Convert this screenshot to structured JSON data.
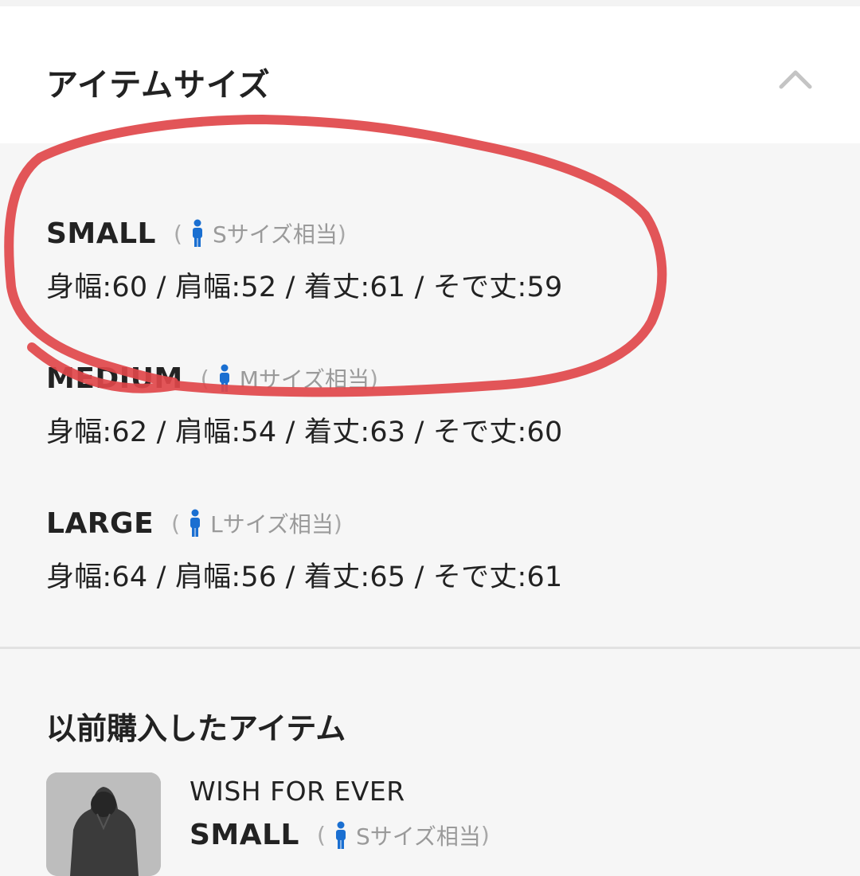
{
  "header": {
    "title": "アイテムサイズ"
  },
  "sizes": [
    {
      "name": "SMALL",
      "equiv_open": "(",
      "equiv": "Sサイズ相当",
      "equiv_close": ")",
      "measure": "身幅:60 / 肩幅:52 / 着丈:61 / そで丈:59"
    },
    {
      "name": "MEDIUM",
      "equiv_open": "(",
      "equiv": "Mサイズ相当",
      "equiv_close": ")",
      "measure": "身幅:62 / 肩幅:54 / 着丈:63 / そで丈:60"
    },
    {
      "name": "LARGE",
      "equiv_open": "(",
      "equiv": "Lサイズ相当",
      "equiv_close": ")",
      "measure": "身幅:64 / 肩幅:56 / 着丈:65 / そで丈:61"
    }
  ],
  "previous": {
    "title": "以前購入したアイテム",
    "item": {
      "name": "WISH FOR EVER",
      "size": "SMALL",
      "equiv_open": "(",
      "equiv": "Sサイズ相当",
      "equiv_close": ")"
    }
  },
  "colors": {
    "person_icon": "#1a6fd1",
    "annotation": "#e0464a"
  },
  "icons": {
    "collapse": "chevron-up-icon",
    "person": "person-icon"
  }
}
